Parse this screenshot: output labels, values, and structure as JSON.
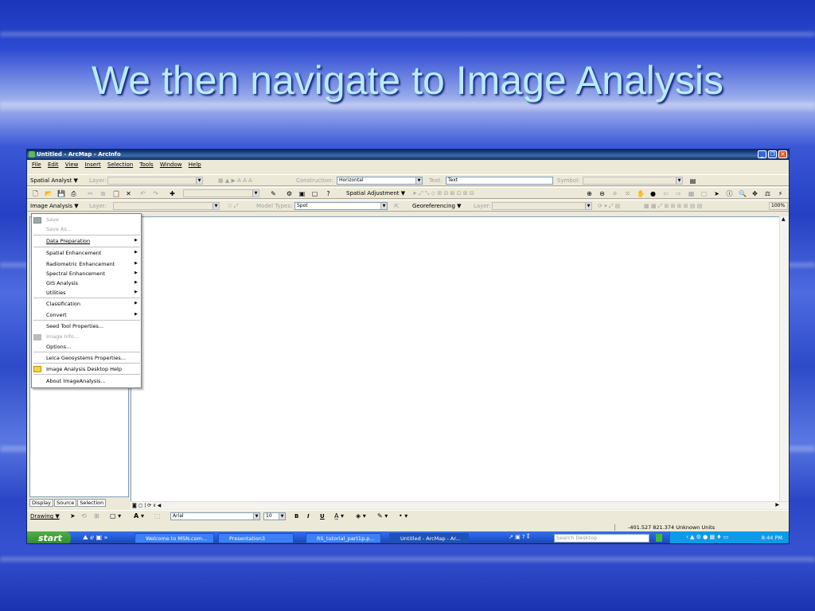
{
  "slide": {
    "title": "We then navigate to Image Analysis"
  },
  "window": {
    "title": "Untitled - ArcMap - ArcInfo",
    "controls": [
      "minimize",
      "maximize",
      "close"
    ]
  },
  "menubar": [
    "File",
    "Edit",
    "View",
    "Insert",
    "Selection",
    "Tools",
    "Window",
    "Help"
  ],
  "toolbars": {
    "row1": {
      "spatial_analyst": "Spatial Analyst ▼",
      "layer_label": "Layer:",
      "construction_label": "Construction:",
      "construction_value": "Horizontal",
      "text_label": "Text:",
      "text_value": "Text",
      "symbol_label": "Symbol:"
    },
    "row2": {
      "spatial_adjustment": "Spatial Adjustment ▼",
      "zoom": "100%"
    },
    "row3": {
      "image_analysis": "Image Analysis ▼",
      "layer_label": "Layer:",
      "model_types_label": "Model Types:",
      "model_types_value": "Spot",
      "georeferencing": "Georeferencing ▼",
      "layer2_label": "Layer:"
    }
  },
  "image_analysis_menu": {
    "items": [
      {
        "label": "Save",
        "disabled": true,
        "icon": "save-icon"
      },
      {
        "label": "Save As...",
        "disabled": true
      },
      {
        "label": "Data Preparation",
        "submenu": true
      },
      {
        "label": "Spatial Enhancement",
        "submenu": true
      },
      {
        "label": "Radiometric Enhancement",
        "submenu": true
      },
      {
        "label": "Spectral Enhancement",
        "submenu": true
      },
      {
        "label": "GIS Analysis",
        "submenu": true
      },
      {
        "label": "Utilities",
        "submenu": true
      },
      {
        "label": "Classification",
        "submenu": true
      },
      {
        "label": "Convert",
        "submenu": true
      },
      {
        "label": "Seed Tool Properties..."
      },
      {
        "label": "Image Info...",
        "disabled": true,
        "icon": "image-info-icon"
      },
      {
        "label": "Options..."
      },
      {
        "label": "Leica Geosystems Properties..."
      },
      {
        "label": "Image Analysis Desktop Help",
        "icon": "help-icon"
      },
      {
        "label": "About ImageAnalysis..."
      }
    ]
  },
  "toc_tabs": [
    "Display",
    "Source",
    "Selection"
  ],
  "drawing_toolbar": {
    "drawing": "Drawing ▼",
    "font": "Arial",
    "size": "10",
    "bold": "B",
    "italic": "I",
    "underline": "U"
  },
  "status": {
    "coords": "-401.527  821.374 Unknown Units"
  },
  "taskbar": {
    "start": "start",
    "tasks": [
      "Welcome to MSN.com...",
      "Presentation3",
      "RS_tutorial_part1p.p...",
      "Untitled - ArcMap - Ar..."
    ],
    "search_placeholder": "Search Desktop",
    "clock": "8:44 PM"
  },
  "colors": {
    "title_text": "#b9ecff",
    "background": "#2c4ad2",
    "window_chrome": "#ece9d8",
    "titlebar": "#0a246a",
    "taskbar": "#245edb"
  }
}
